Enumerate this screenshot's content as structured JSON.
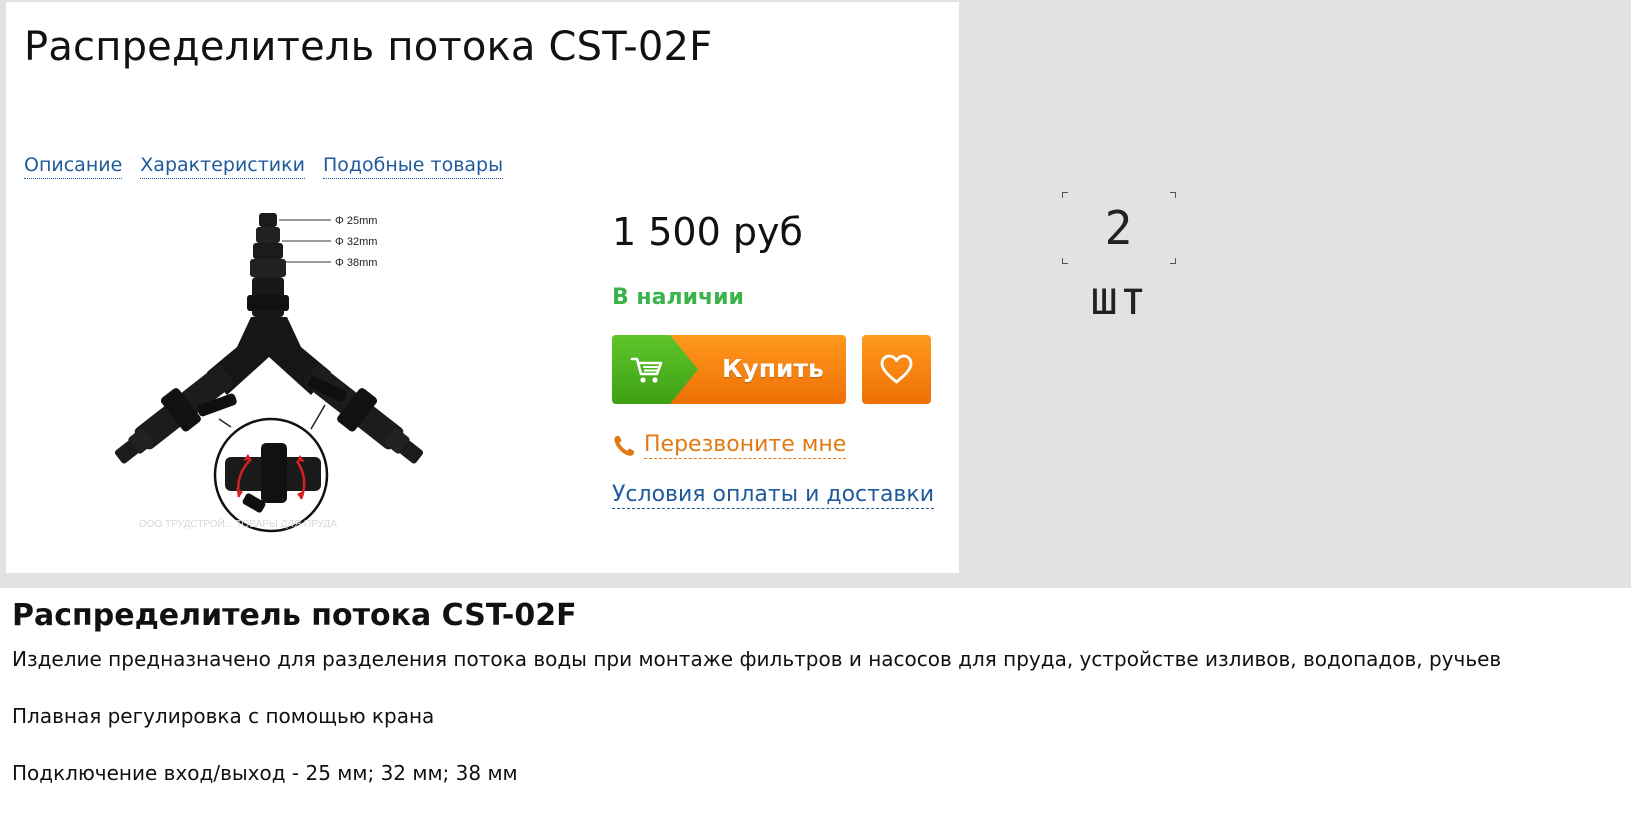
{
  "product": {
    "title": "Распределитель потока CST-02F",
    "price": "1 500 руб",
    "stock": "В наличии"
  },
  "tabs": [
    {
      "label": "Описание"
    },
    {
      "label": "Характеристики"
    },
    {
      "label": "Подобные товары"
    }
  ],
  "image": {
    "callouts": [
      "Φ 25mm",
      "Φ 32mm",
      "Φ 38mm"
    ],
    "watermark": "ООО ТРУДСТРОЙ... ТОВАРЫ ДЛЯ ПРУДА"
  },
  "actions": {
    "buy_label": "Купить",
    "callback_label": "Перезвоните мне",
    "delivery_label": "Условия оплаты и доставки"
  },
  "quantity": {
    "value": "2 шт"
  },
  "description": {
    "title": "Распределитель потока CST-02F",
    "paragraphs": [
      "Изделие предназначено для разделения потока воды при монтаже фильтров и насосов для пруда, устройстве изливов, водопадов, ручьев",
      "Плавная регулировка с помощью крана",
      "Подключение вход/выход - 25 мм; 32 мм; 38 мм"
    ]
  },
  "colors": {
    "link": "#1f5a9c",
    "stock_green": "#3cb24a",
    "buy_orange": "#f7820f",
    "buy_green": "#4fb41f",
    "callback_orange": "#e07a15",
    "band_gray": "#e2e2e2"
  },
  "icons": [
    "cart-icon",
    "heart-icon",
    "phone-icon"
  ]
}
